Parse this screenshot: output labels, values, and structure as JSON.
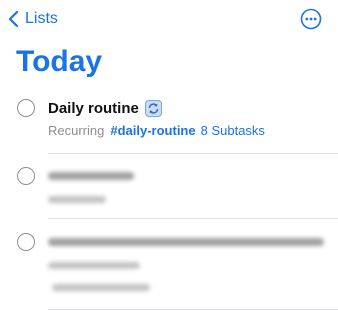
{
  "nav": {
    "back_label": "Lists",
    "back_icon": "chevron-left-icon",
    "more_icon": "ellipsis-circle-icon"
  },
  "page": {
    "title": "Today"
  },
  "tasks": [
    {
      "title": "Daily routine",
      "icon": "recurring-icon",
      "recurring_label": "Recurring",
      "tag": "#daily-routine",
      "subtasks": "8 Subtasks"
    }
  ],
  "colors": {
    "accent": "#1a73e8",
    "secondary_text": "#8e8e93",
    "divider": "#e2e2e6"
  }
}
